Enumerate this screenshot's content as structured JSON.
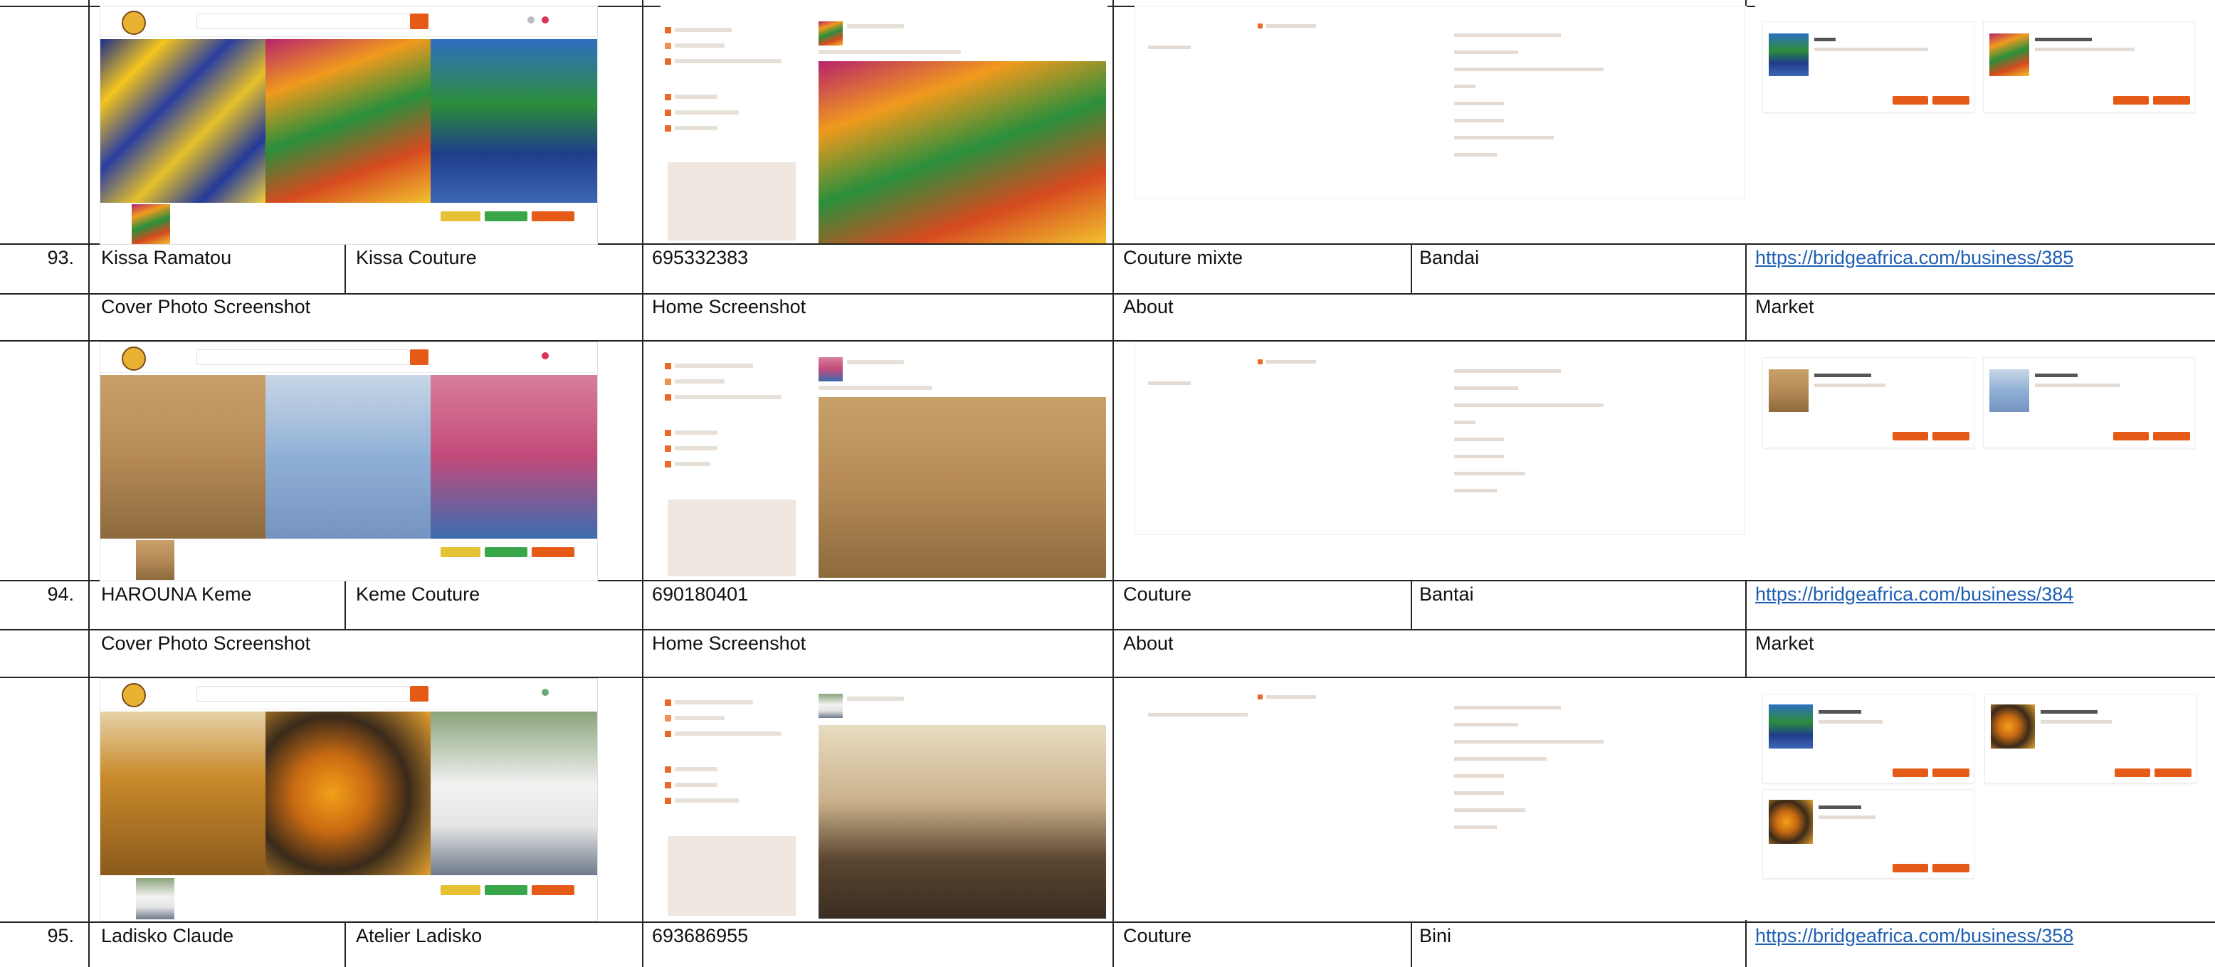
{
  "labels": {
    "cover": "Cover Photo Screenshot",
    "home": "Home Screenshot",
    "about": "About",
    "market": "Market"
  },
  "rows": [
    {
      "num": "93.",
      "name": "Kissa Ramatou",
      "business": "Kissa Couture",
      "phone": "695332383",
      "category": "Couture mixte",
      "location": "Bandai",
      "url": "https://bridgeafrica.com/business/385"
    },
    {
      "num": "94.",
      "name": "HAROUNA Keme",
      "business": "Keme Couture",
      "phone": "690180401",
      "category": "Couture",
      "location": "Bantai",
      "url": "https://bridgeafrica.com/business/384"
    },
    {
      "num": "95.",
      "name": "Ladisko Claude",
      "business": "Atelier Ladisko",
      "phone": "693686955",
      "category": "Couture",
      "location": "Bini",
      "url": "https://bridgeafrica.com/business/358"
    }
  ],
  "colors": {
    "accent": "#e65a18",
    "link": "#1f5fb4",
    "grid": "#222222"
  }
}
